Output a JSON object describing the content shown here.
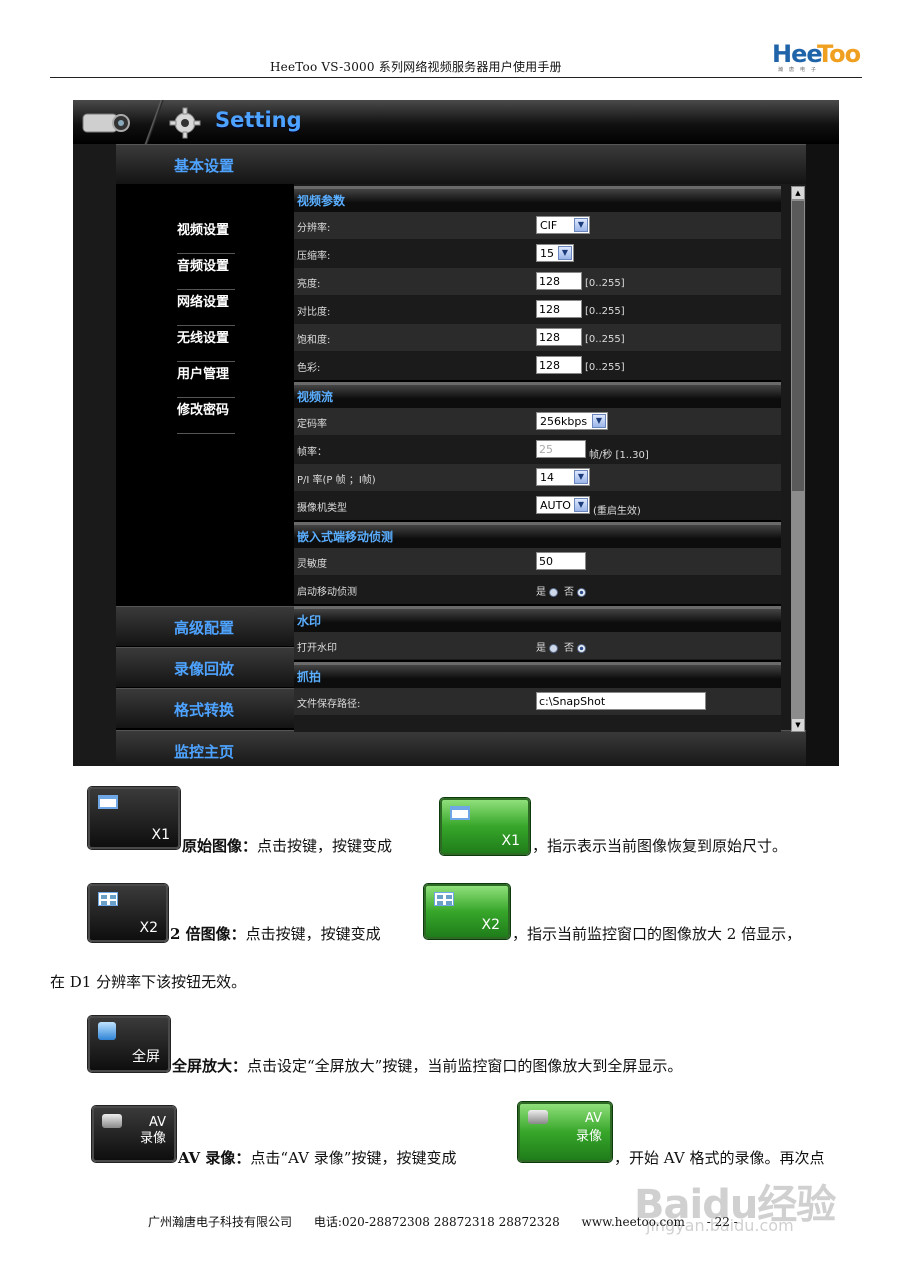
{
  "header": {
    "title": "HeeToo    VS-3000 系列网络视频服务器用户使用手册",
    "logo_text": "HeeToo",
    "logo_sub": "瀚 唐 电 子"
  },
  "ui": {
    "setting_title": "Setting",
    "nav_top": "基本设置",
    "menu": [
      "视频设置",
      "音频设置",
      "网络设置",
      "无线设置",
      "用户管理",
      "修改密码"
    ],
    "nav_bottom": [
      "高级配置",
      "录像回放",
      "格式转换",
      "监控主页"
    ],
    "sections": {
      "video_params": "视频参数",
      "video_stream": "视频流",
      "motion": "嵌入式端移动侦测",
      "watermark": "水印",
      "snapshot": "抓拍"
    },
    "rows": {
      "resolution": {
        "label": "分辨率:",
        "value": "CIF"
      },
      "compression": {
        "label": "压缩率:",
        "value": "15"
      },
      "brightness": {
        "label": "亮度:",
        "value": "128",
        "range": "[0..255]"
      },
      "contrast": {
        "label": "对比度:",
        "value": "128",
        "range": "[0..255]"
      },
      "saturation": {
        "label": "饱和度:",
        "value": "128",
        "range": "[0..255]"
      },
      "hue": {
        "label": "色彩:",
        "value": "128",
        "range": "[0..255]"
      },
      "bitrate": {
        "label": "定码率",
        "value": "256kbps"
      },
      "framerate": {
        "label": "帧率：",
        "value": "25",
        "unit": "帧/秒  [1..30]"
      },
      "pi_ratio": {
        "label": "P/I 率(P 帧 ；I帧)",
        "value": "14"
      },
      "camera_type": {
        "label": "摄像机类型",
        "value": "AUTO",
        "note": "(重启生效)"
      },
      "sensitivity": {
        "label": "灵敏度",
        "value": "50"
      },
      "motion_enable": {
        "label": "启动移动侦测",
        "yes": "是",
        "no": "否"
      },
      "watermark_enable": {
        "label": "打开水印",
        "yes": "是",
        "no": "否"
      },
      "save_path": {
        "label": "文件保存路径:",
        "value": "c:\\SnapShot"
      }
    }
  },
  "buttons": {
    "x1": "X1",
    "x2": "X2",
    "fullscreen": "全屏",
    "av_line1": "AV",
    "av_line2": "录像"
  },
  "paragraphs": {
    "p1_bold": "原始图像：",
    "p1_a": "点击按键，按键变成",
    "p1_b": "，指示表示当前图像恢复到原始尺寸。",
    "p2_bold": "2 倍图像：",
    "p2_a": "点击按键，按键变成",
    "p2_b": "，指示当前监控窗口的图像放大 2 倍显示，",
    "p2_c": "在 D1 分辨率下该按钮无效。",
    "p3_bold": "全屏放大：",
    "p3_a": "点击设定“全屏放大”按键，当前监控窗口的图像放大到全屏显示。",
    "p4_bold": "AV 录像：",
    "p4_a": "点击“AV 录像”按键，按键变成",
    "p4_b": "，开始 AV 格式的录像。再次点"
  },
  "footer": {
    "company": "广州瀚唐电子科技有限公司",
    "phone": "电话:020-28872308    28872318    28872328",
    "web": "www.heetoo.com",
    "page": "- 22 -"
  },
  "watermark": {
    "big": "Baidu经验",
    "small": "jingyan.baidu.com"
  }
}
